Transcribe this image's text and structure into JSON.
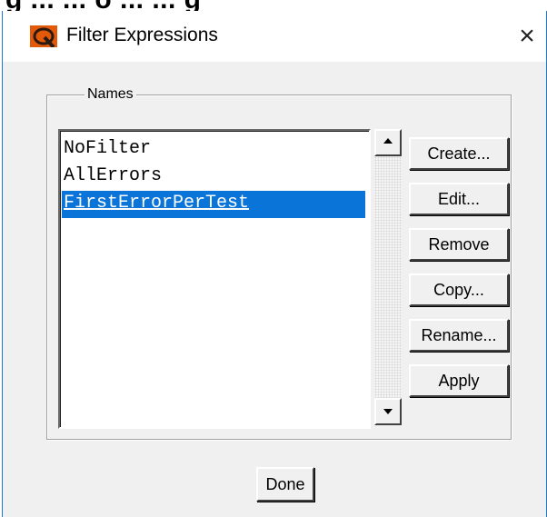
{
  "background_window": {
    "clipped_text": "g ... ... o ... ... g"
  },
  "titlebar": {
    "title": "Filter Expressions",
    "close_symbol": "×",
    "app_icon": "q-logo-icon"
  },
  "names_group": {
    "legend": "Names",
    "items": [
      "NoFilter",
      "AllErrors",
      "FirstErrorPerTest"
    ],
    "selected_index": 2
  },
  "buttons": {
    "create": "Create...",
    "edit": "Edit...",
    "remove": "Remove",
    "copy": "Copy...",
    "rename": "Rename...",
    "apply": "Apply"
  },
  "footer": {
    "done": "Done"
  },
  "colors": {
    "accent": "#1b7ad6",
    "selection": "#0a74d8",
    "icon_orange": "#e2590a",
    "face": "#f0f0f0"
  }
}
